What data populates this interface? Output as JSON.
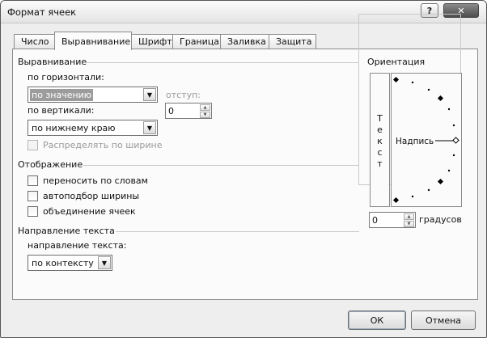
{
  "window": {
    "title": "Формат ячеек",
    "help_label": "?",
    "close_label": "✕"
  },
  "tabs": [
    {
      "label": "Число"
    },
    {
      "label": "Выравнивание"
    },
    {
      "label": "Шрифт"
    },
    {
      "label": "Граница"
    },
    {
      "label": "Заливка"
    },
    {
      "label": "Защита"
    }
  ],
  "alignment": {
    "title": "Выравнивание",
    "horizontal_label": "по горизонтали:",
    "horizontal_value": "по значению",
    "vertical_label": "по вертикали:",
    "vertical_value": "по нижнему краю",
    "indent_label": "отступ:",
    "indent_value": "0",
    "distribute_label": "Распределять по ширине"
  },
  "display": {
    "title": "Отображение",
    "wrap_label": "переносить по словам",
    "shrink_label": "автоподбор ширины",
    "merge_label": "объединение ячеек"
  },
  "direction": {
    "title": "Направление текста",
    "label": "направление текста:",
    "value": "по контексту"
  },
  "orientation": {
    "title": "Ориентация",
    "vertical_text": [
      "Т",
      "е",
      "к",
      "с",
      "т"
    ],
    "arc_label": "Надпись",
    "degrees_value": "0",
    "degrees_label": "градусов"
  },
  "buttons": {
    "ok": "ОК",
    "cancel": "Отмена"
  }
}
